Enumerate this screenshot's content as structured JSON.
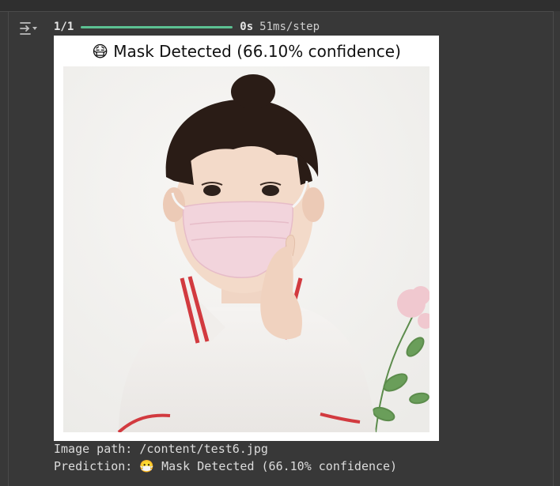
{
  "progress": {
    "count": "1/1",
    "fraction": 1.0,
    "time": "0s",
    "step": "51ms/step",
    "fill_color": "#5cc192"
  },
  "figure": {
    "title": "😷 Mask Detected (66.10% confidence)"
  },
  "output": {
    "line1": "Image path: /content/test6.jpg",
    "line2": "Prediction: 😷 Mask Detected (66.10% confidence)"
  },
  "icons": {
    "output_toggle": "output-collapse-icon"
  }
}
